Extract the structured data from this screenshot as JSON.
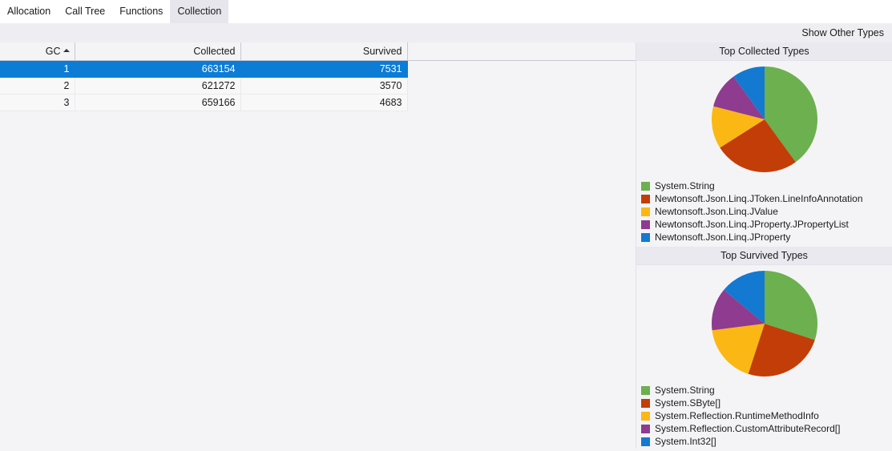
{
  "tabs": [
    {
      "label": "Allocation",
      "selected": false
    },
    {
      "label": "Call Tree",
      "selected": false
    },
    {
      "label": "Functions",
      "selected": false
    },
    {
      "label": "Collection",
      "selected": true
    }
  ],
  "commandbar": {
    "show_other_types_label": "Show Other Types"
  },
  "grid": {
    "columns": [
      "GC",
      "Collected",
      "Survived",
      ""
    ],
    "sort_column": "GC",
    "sort_direction": "ascending",
    "sort_indicator_icon": "sort-ascending-triangle-icon",
    "rows": [
      {
        "gc": "1",
        "collected": "663154",
        "survived": "7531",
        "selected": true
      },
      {
        "gc": "2",
        "collected": "621272",
        "survived": "3570",
        "selected": false
      },
      {
        "gc": "3",
        "collected": "659166",
        "survived": "4683",
        "selected": false
      }
    ]
  },
  "colors": {
    "green": "#6CB04F",
    "red": "#C33D08",
    "yellow": "#FBB714",
    "purple": "#8E3B90",
    "blue": "#1479D0",
    "selection": "#0C7CD5",
    "panel_header": "#E9E9EF",
    "background": "#F4F4F6"
  },
  "chart_data": [
    {
      "type": "pie",
      "title": "Top Collected Types",
      "legend_position": "bottom-left",
      "categories": [
        "System.String",
        "Newtonsoft.Json.Linq.JToken.LineInfoAnnotation",
        "Newtonsoft.Json.Linq.JValue",
        "Newtonsoft.Json.Linq.JProperty.JPropertyList",
        "Newtonsoft.Json.Linq.JProperty"
      ],
      "values": [
        40,
        26,
        13,
        11,
        10
      ],
      "colors": [
        "#6CB04F",
        "#C33D08",
        "#FBB714",
        "#8E3B90",
        "#1479D0"
      ]
    },
    {
      "type": "pie",
      "title": "Top Survived Types",
      "legend_position": "bottom-left",
      "categories": [
        "System.String",
        "System.SByte[]",
        "System.Reflection.RuntimeMethodInfo",
        "System.Reflection.CustomAttributeRecord[]",
        "System.Int32[]"
      ],
      "values": [
        30,
        25,
        18,
        13,
        14
      ],
      "colors": [
        "#6CB04F",
        "#C33D08",
        "#FBB714",
        "#8E3B90",
        "#1479D0"
      ]
    }
  ]
}
